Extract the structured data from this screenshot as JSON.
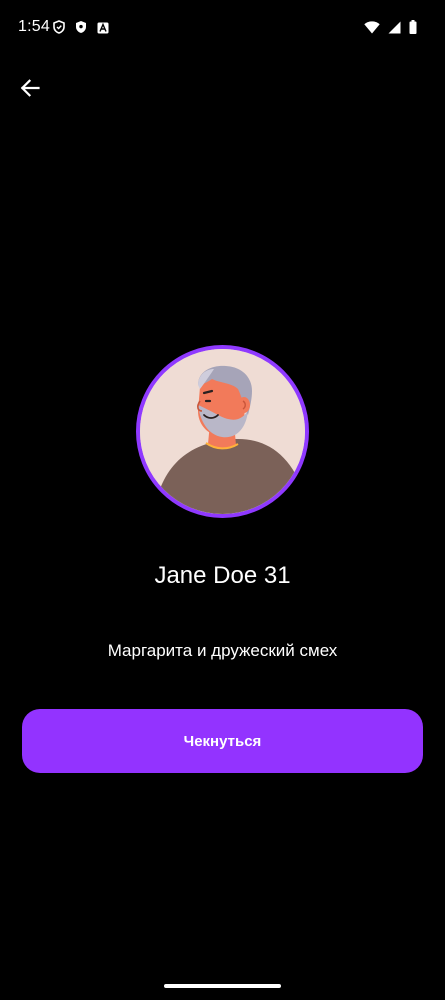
{
  "status_bar": {
    "time": "1:54",
    "left_icons": [
      "shield-outline-icon",
      "shield-filled-icon",
      "font-a-icon"
    ],
    "right_icons": [
      "wifi-icon",
      "signal-icon",
      "battery-icon"
    ]
  },
  "top_bar": {
    "back_icon": "arrow-left-icon"
  },
  "profile": {
    "name": "Jane Doe 31",
    "status": "Маргарита и дружеский смех",
    "avatar_ring_color": "#8f39ff"
  },
  "actions": {
    "check_in_label": "Чекнуться",
    "button_color": "#9333ff"
  }
}
